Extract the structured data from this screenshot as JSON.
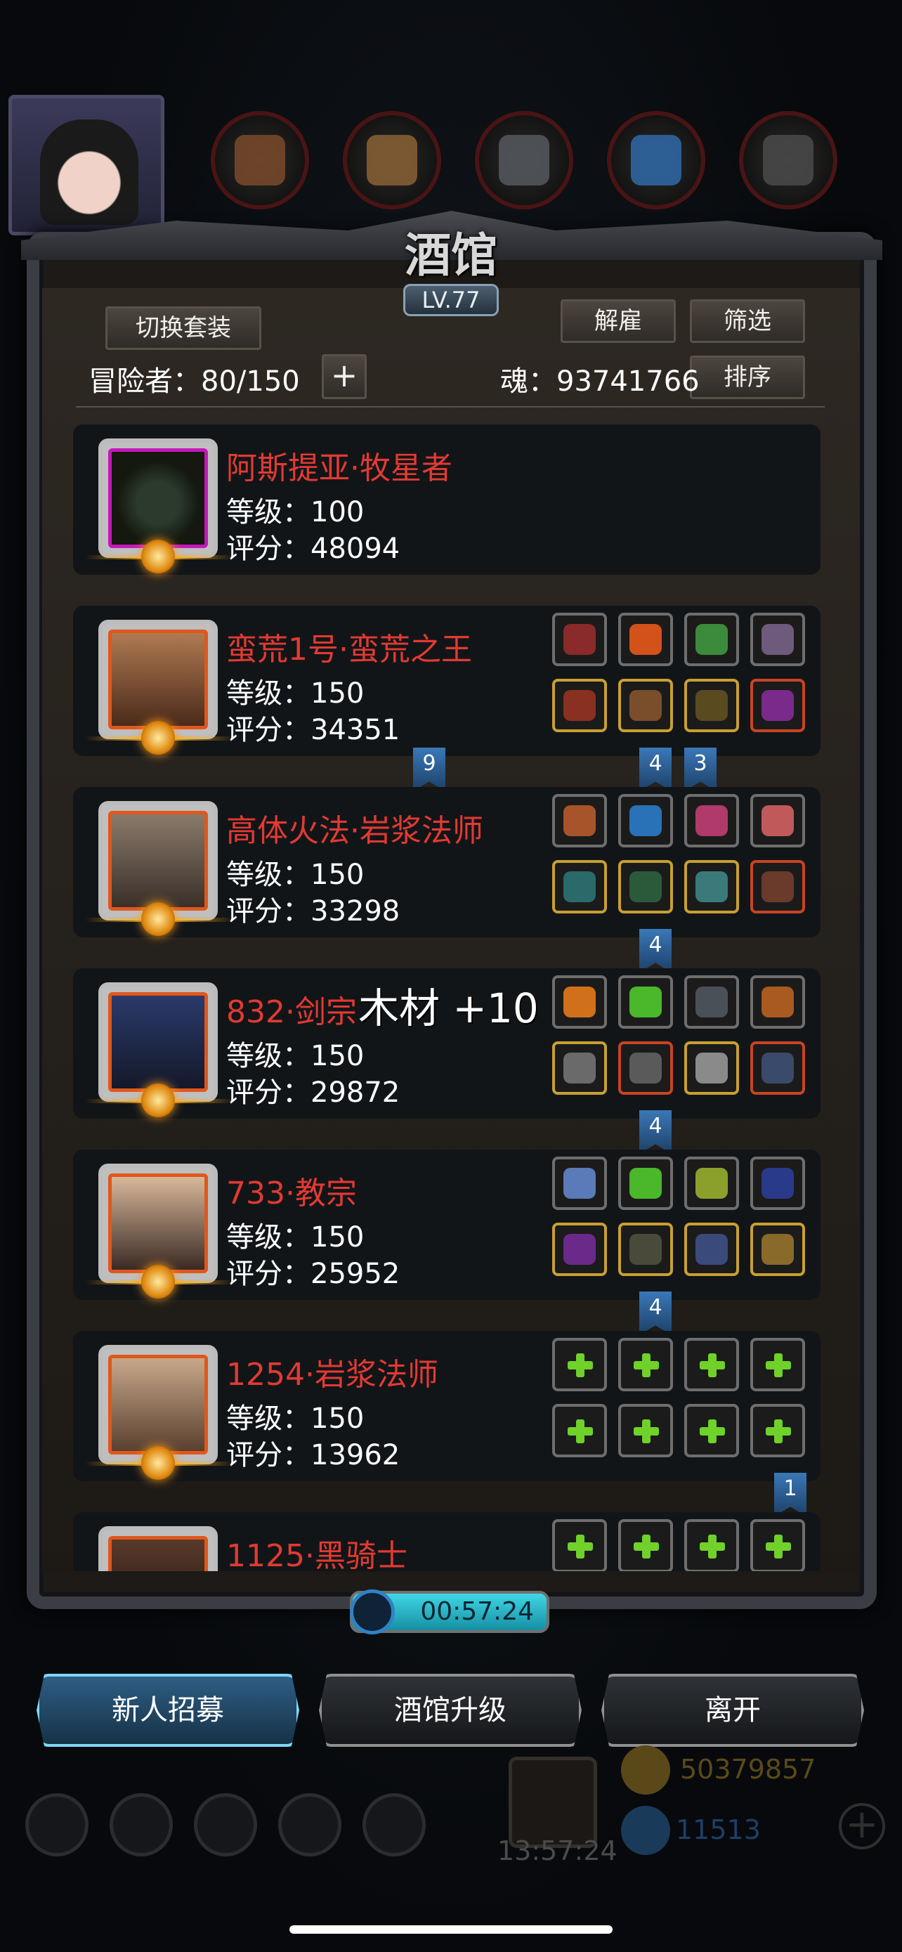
{
  "title": "酒馆",
  "level": "LV.77",
  "buttons": {
    "switch_outfit": "切换套装",
    "dismiss": "解雇",
    "filter": "筛选",
    "sort": "排序",
    "add": "+"
  },
  "adventurers_label": "冒险者：80/150",
  "soul_label": "魂：93741766",
  "heroes": [
    {
      "name": "阿斯提亚·牧星者",
      "level": "等级：100",
      "score": "评分：48094"
    },
    {
      "name": "蛮荒1号·蛮荒之王",
      "level": "等级：150",
      "score": "评分：34351"
    },
    {
      "name": "高体火法·岩浆法师",
      "level": "等级：150",
      "score": "评分：33298"
    },
    {
      "name": "832·剑宗",
      "level": "等级：150",
      "score": "评分：29872"
    },
    {
      "name": "733·教宗",
      "level": "等级：150",
      "score": "评分：25952"
    },
    {
      "name": "1254·岩浆法师",
      "level": "等级：150",
      "score": "评分：13962"
    },
    {
      "name": "1125·黑骑士",
      "level": "",
      "score": ""
    }
  ],
  "tags": [
    "9",
    "4",
    "3",
    "4",
    "4",
    "4",
    "1"
  ],
  "floating_text": "木材 +10",
  "timer": "00:57:24",
  "bottom_buttons": {
    "recruit": "新人招募",
    "upgrade": "酒馆升级",
    "leave": "离开"
  },
  "hud": {
    "chest_timer": "13:57:24",
    "gold": "50379857",
    "gems": "11513",
    "plus": "+"
  },
  "colors": {
    "hero_name": "#e23a32",
    "primary_glow": "#3fb8ff",
    "timer_fill": "#3fd7e6",
    "add_icon": "#6fd12a"
  }
}
